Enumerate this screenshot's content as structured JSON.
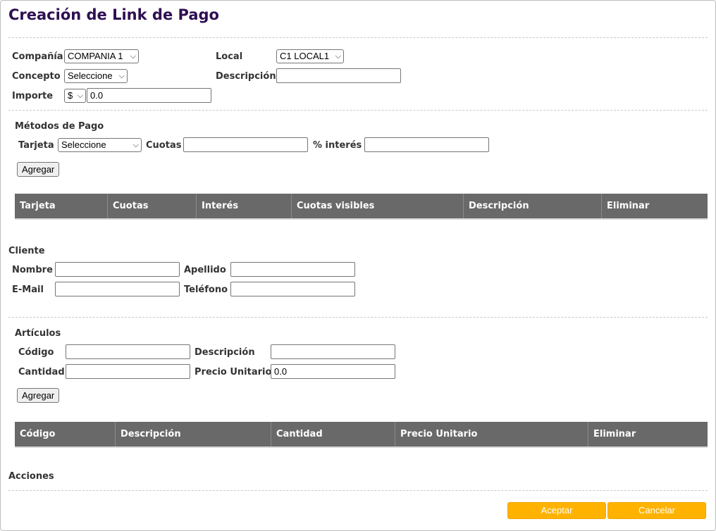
{
  "page": {
    "title": "Creación de Link de Pago"
  },
  "general": {
    "company_label": "Compañía",
    "company_value": "COMPANIA 1",
    "local_label": "Local",
    "local_value": "C1 LOCAL1",
    "concept_label": "Concepto",
    "concept_value": "Seleccione",
    "description_label": "Descripción",
    "description_value": "",
    "amount_label": "Importe",
    "currency_value": "$",
    "amount_value": "0.0"
  },
  "payment_methods": {
    "section_title": "Métodos de Pago",
    "card_label": "Tarjeta",
    "card_value": "Seleccione",
    "installments_label": "Cuotas",
    "installments_value": "",
    "interest_label": "% interés",
    "interest_value": "",
    "add_button": "Agregar",
    "columns": [
      "Tarjeta",
      "Cuotas",
      "Interés",
      "Cuotas visibles",
      "Descripción",
      "Eliminar"
    ]
  },
  "client": {
    "section_title": "Cliente",
    "name_label": "Nombre",
    "name_value": "",
    "surname_label": "Apellido",
    "surname_value": "",
    "email_label": "E-Mail",
    "email_value": "",
    "phone_label": "Teléfono",
    "phone_value": ""
  },
  "items": {
    "section_title": "Artículos",
    "code_label": "Código",
    "code_value": "",
    "description_label": "Descripción",
    "description_value": "",
    "quantity_label": "Cantidad",
    "quantity_value": "",
    "unit_price_label": "Precio Unitario",
    "unit_price_value": "0.0",
    "add_button": "Agregar",
    "columns": [
      "Código",
      "Descripción",
      "Cantidad",
      "Precio Unitario",
      "Eliminar"
    ]
  },
  "actions": {
    "section_title": "Acciones",
    "accept_button": "Aceptar",
    "cancel_button": "Cancelar"
  },
  "colors": {
    "title": "#2e0f52",
    "table_header": "#696969",
    "action_button": "#ffb300"
  }
}
